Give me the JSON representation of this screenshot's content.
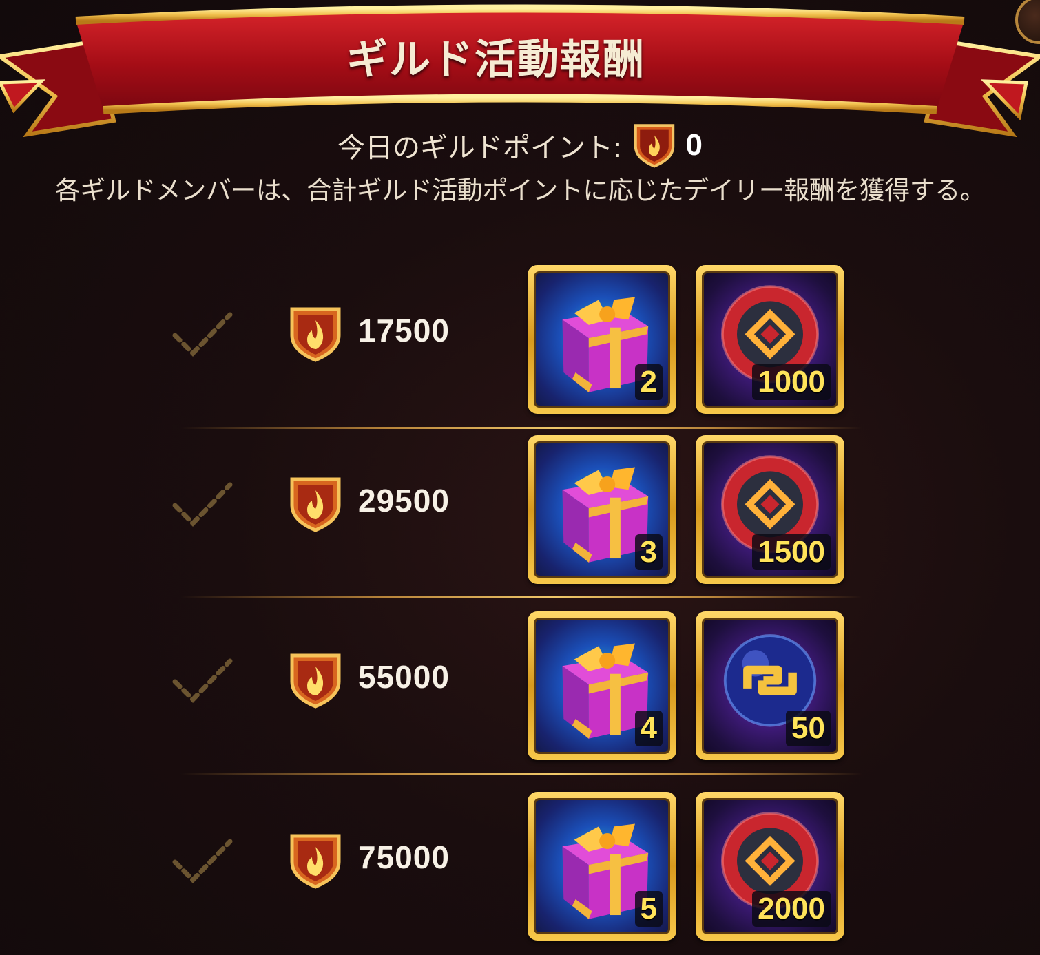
{
  "title": "ギルド活動報酬",
  "points": {
    "label": "今日のギルドポイント:",
    "value": "0",
    "icon": "guild-point-shield-icon"
  },
  "description": "各ギルドメンバーは、合計ギルド活動ポイントに応じたデイリー報酬を獲得する。",
  "colors": {
    "ribbon": "#b5121b",
    "gold": "#f2c14e",
    "quantity": "#ffe35a"
  },
  "rewards": [
    {
      "required": "17500",
      "items": [
        {
          "icon": "gift-box-icon",
          "qty": "2"
        },
        {
          "icon": "red-emblem-coin-icon",
          "qty": "1000"
        }
      ]
    },
    {
      "required": "29500",
      "items": [
        {
          "icon": "gift-box-icon",
          "qty": "3"
        },
        {
          "icon": "red-emblem-coin-icon",
          "qty": "1500"
        }
      ]
    },
    {
      "required": "55000",
      "items": [
        {
          "icon": "gift-box-icon",
          "qty": "4"
        },
        {
          "icon": "blue-orb-icon",
          "qty": "50"
        }
      ]
    },
    {
      "required": "75000",
      "items": [
        {
          "icon": "gift-box-icon",
          "qty": "5"
        },
        {
          "icon": "red-emblem-coin-icon",
          "qty": "2000"
        }
      ]
    }
  ]
}
